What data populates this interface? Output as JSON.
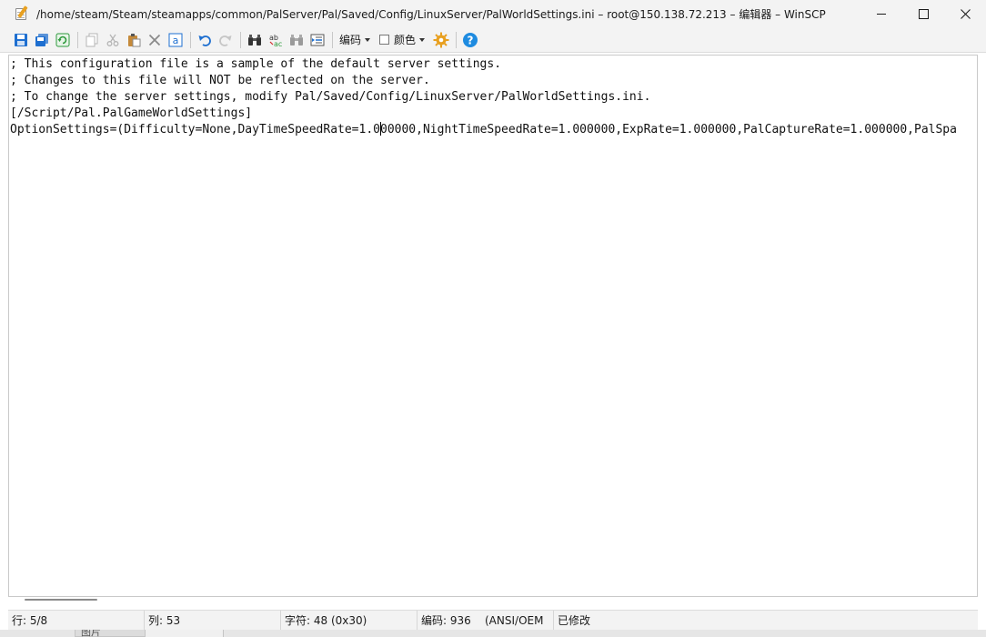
{
  "window": {
    "title": "/home/steam/Steam/steamapps/common/PalServer/Pal/Saved/Config/LinuxServer/PalWorldSettings.ini – root@150.138.72.213 – 编辑器 – WinSCP"
  },
  "toolbar": {
    "encoding_label": "编码",
    "color_label": "颜色"
  },
  "editor": {
    "lines": [
      "; This configuration file is a sample of the default server settings.",
      "; Changes to this file will NOT be reflected on the server.",
      "; To change the server settings, modify Pal/Saved/Config/LinuxServer/PalWorldSettings.ini.",
      "[/Script/Pal.PalGameWorldSettings]"
    ],
    "line5_before_caret": "OptionSettings=(Difficulty=None,DayTimeSpeedRate=1.0",
    "line5_after_caret": "00000,NightTimeSpeedRate=1.000000,ExpRate=1.000000,PalCaptureRate=1.000000,PalSpa"
  },
  "status": {
    "line": "行: 5/8",
    "col": "列: 53",
    "char": "字符: 48 (0x30)",
    "encoding": "编码: 936",
    "encoding_name": "(ANSI/OEM",
    "modified": "已修改"
  },
  "background": {
    "tab1": "图片"
  },
  "colors": {
    "accent_blue": "#1e6fd0",
    "toolbar_bg": "#f3f3f3",
    "gear_orange": "#e8a020",
    "refresh_green": "#2e9a3c"
  }
}
